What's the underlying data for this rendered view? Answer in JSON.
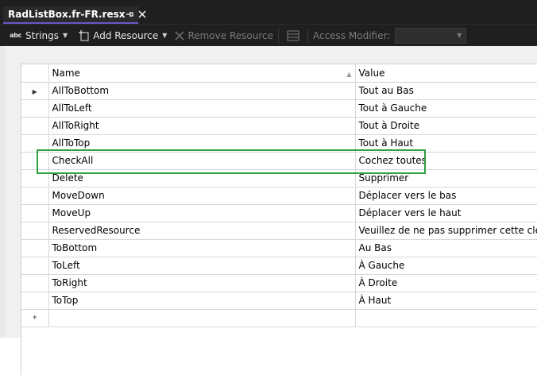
{
  "tab": {
    "title": "RadListBox.fr-FR.resx"
  },
  "toolbar": {
    "strings_label": "Strings",
    "add_resource_label": "Add Resource",
    "remove_resource_label": "Remove Resource",
    "access_modifier_label": "Access Modifier:",
    "access_modifier_value": ""
  },
  "grid": {
    "columns": {
      "name": "Name",
      "value": "Value"
    },
    "rows": [
      {
        "name": "AllToBottom",
        "value": "Tout au Bas"
      },
      {
        "name": "AllToLeft",
        "value": "Tout à Gauche"
      },
      {
        "name": "AllToRight",
        "value": "Tout à Droite"
      },
      {
        "name": "AllToTop",
        "value": "Tout à Haut"
      },
      {
        "name": "CheckAll",
        "value": "Cochez toutes"
      },
      {
        "name": "Delete",
        "value": "Supprimer"
      },
      {
        "name": "MoveDown",
        "value": "Déplacer vers le bas"
      },
      {
        "name": "MoveUp",
        "value": "Déplacer vers le haut"
      },
      {
        "name": "ReservedResource",
        "value": "Veuillez de ne pas supprimer cette clé."
      },
      {
        "name": "ToBottom",
        "value": "Au Bas"
      },
      {
        "name": "ToLeft",
        "value": "À Gauche"
      },
      {
        "name": "ToRight",
        "value": "À Droite"
      },
      {
        "name": "ToTop",
        "value": "À Haut"
      }
    ]
  },
  "colors": {
    "highlight": "#2ea043",
    "tab_accent": "#6d56c9"
  },
  "icons": {
    "strings": "abc-icon",
    "add": "add-resource-icon",
    "remove": "remove-icon",
    "pin": "pin-icon",
    "close": "close-icon",
    "current_row": "row-selector-arrow-icon",
    "new_row": "new-row-star-icon"
  }
}
